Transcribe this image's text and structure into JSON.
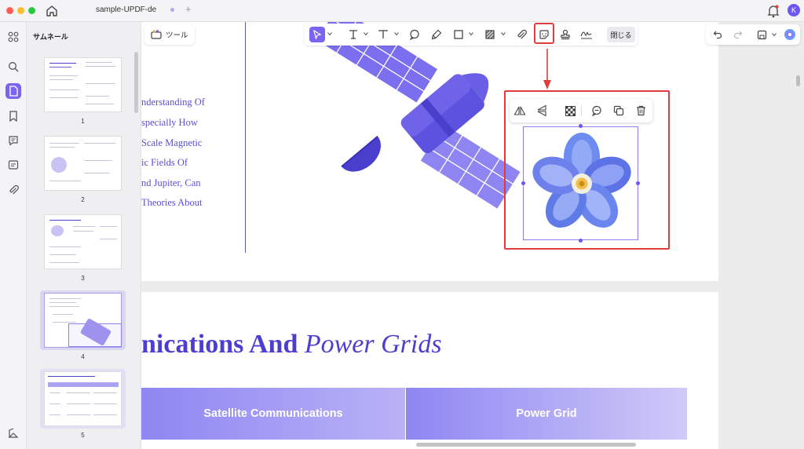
{
  "window": {
    "tab_title": "sample-UPDF-de",
    "tab_plus": "+",
    "avatar_letter": "K"
  },
  "sidebar": {
    "title": "サムネール",
    "thumbnails": [
      {
        "page": "1",
        "heading": "Formation Of The Earth's Magnetic Field"
      },
      {
        "page": "2"
      },
      {
        "page": "3",
        "heading": "Evidence For The Theories"
      },
      {
        "page": "4"
      },
      {
        "page": "5",
        "heading": "Satellite Communications And Power Grids"
      }
    ]
  },
  "toolbar": {
    "tools_label": "ツール",
    "close_label": "閉じる",
    "icons": [
      "select-icon",
      "text-box-icon",
      "text-icon",
      "comment-icon",
      "highlighter-icon",
      "shape-icon",
      "area-icon",
      "attachment-icon",
      "sticker-icon",
      "stamp-icon",
      "signature-icon"
    ]
  },
  "document": {
    "page1_lines": [
      "nderstanding Of",
      "specially How",
      "Scale Magnetic",
      "ic Fields Of",
      "nd Jupiter, Can",
      "Theories About"
    ],
    "page2_heading_bold": "nications And",
    "page2_heading_italic": "Power Grids",
    "table_headers": [
      "Satellite Communications",
      "Power Grid"
    ]
  },
  "image_toolbar": {
    "icons": [
      "flip-horizontal-icon",
      "flip-vertical-icon",
      "transparency-icon",
      "comment-icon",
      "copy-icon",
      "delete-icon"
    ]
  },
  "colors": {
    "accent": "#6b57f1",
    "highlight": "#e23b3b",
    "doc_text": "#5a4fd8"
  }
}
